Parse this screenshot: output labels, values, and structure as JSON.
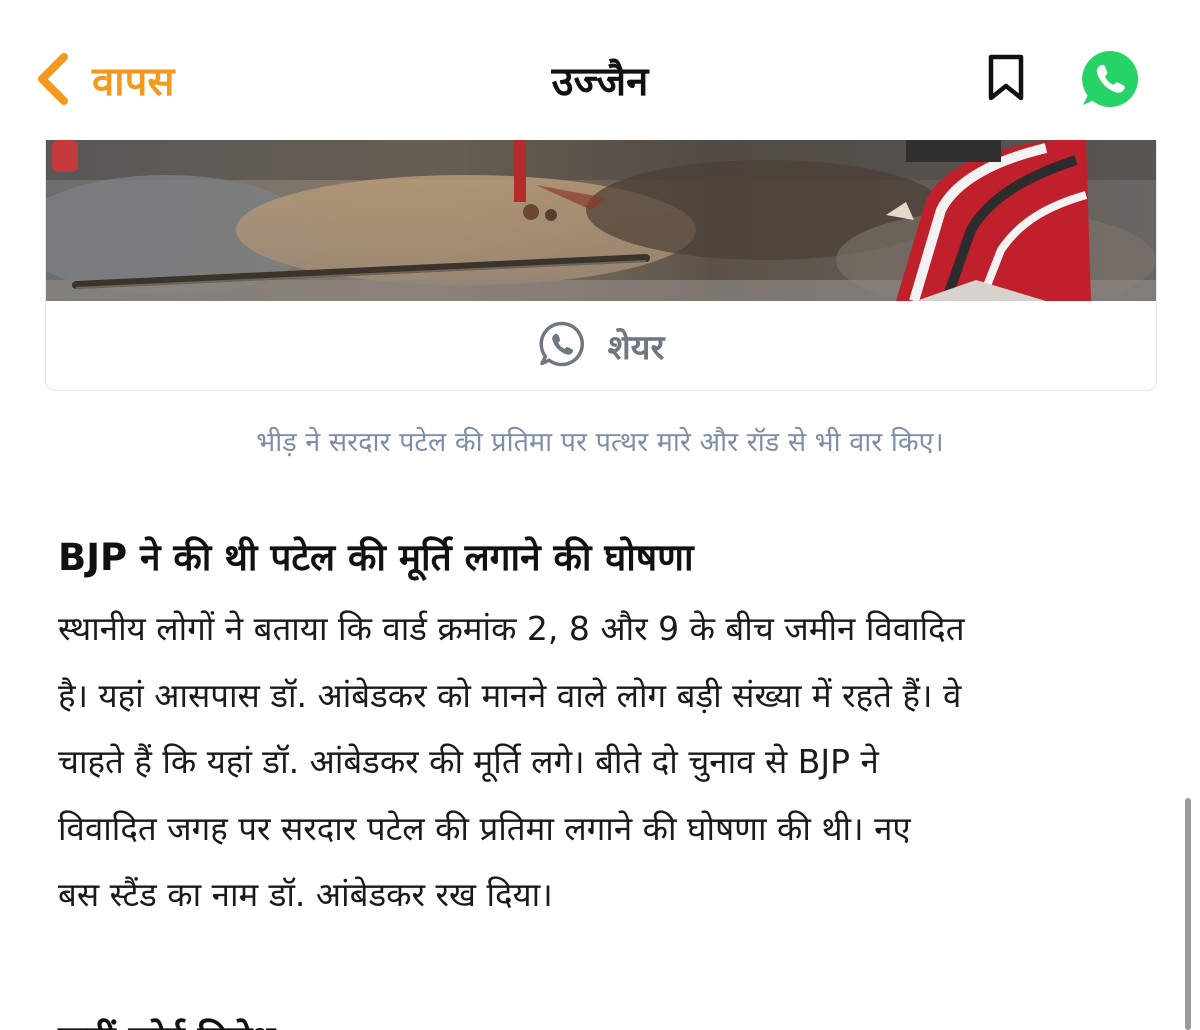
{
  "header": {
    "back_label": "वापस",
    "title": "उज्जैन",
    "back_icon": "chevron-left-icon",
    "bookmark_icon": "bookmark-icon",
    "share_icon": "whatsapp-icon"
  },
  "colors": {
    "accent": "#f39a1e",
    "whatsapp": "#25d366",
    "caption": "#7e8ea6",
    "share_gray": "#6f7781"
  },
  "image_card": {
    "share_label": "शेयर",
    "share_icon": "whatsapp-outline-icon"
  },
  "article": {
    "caption": "भीड़ ने सरदार पटेल की प्रतिमा पर पत्थर मारे और रॉड से भी वार किए।",
    "subheading": "BJP ने की थी पटेल की मूर्ति लगाने की घोषणा",
    "body_lines": [
      "स्थानीय लोगों ने बताया कि वार्ड क्रमांक 2, 8 और 9 के बीच जमीन विवादित",
      "है। यहां आसपास डॉ. आंबेडकर को मानने वाले लोग बड़ी संख्या में रहते हैं। वे",
      "चाहते हैं कि यहां डॉ. आंबेडकर की मूर्ति लगे। बीते दो चुनाव से BJP ने",
      "विवादित जगह पर सरदार पटेल की प्रतिमा लगाने की घोषणा की थी। नए",
      "बस स्टैंड का नाम डॉ. आंबेडकर रख दिया।"
    ],
    "next_heading_partial": "कहीं कोई विरोध"
  }
}
